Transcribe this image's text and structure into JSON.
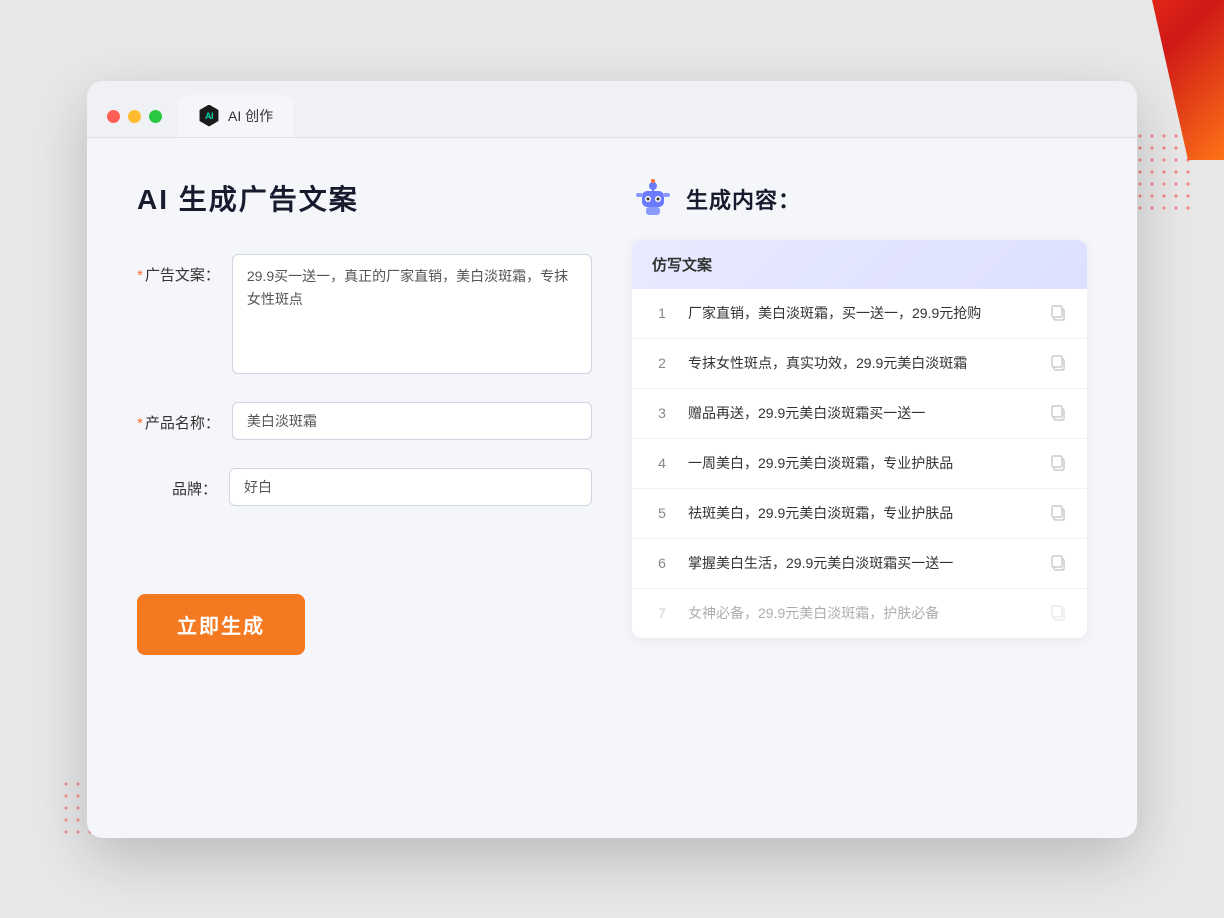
{
  "window": {
    "tab_label": "AI 创作",
    "dot_colors": [
      "#ff5f57",
      "#febc2e",
      "#28c840"
    ]
  },
  "left_panel": {
    "title": "AI 生成广告文案",
    "form": {
      "ad_copy_label": "广告文案：",
      "ad_copy_required": "*",
      "ad_copy_value": "29.9买一送一，真正的厂家直销，美白淡斑霜，专抹女性斑点",
      "product_name_label": "产品名称：",
      "product_name_required": "*",
      "product_name_value": "美白淡斑霜",
      "brand_label": "品牌：",
      "brand_value": "好白",
      "generate_btn": "立即生成"
    }
  },
  "right_panel": {
    "title": "生成内容：",
    "table_header": "仿写文案",
    "results": [
      {
        "num": 1,
        "text": "厂家直销，美白淡斑霜，买一送一，29.9元抢购",
        "dimmed": false
      },
      {
        "num": 2,
        "text": "专抹女性斑点，真实功效，29.9元美白淡斑霜",
        "dimmed": false
      },
      {
        "num": 3,
        "text": "赠品再送，29.9元美白淡斑霜买一送一",
        "dimmed": false
      },
      {
        "num": 4,
        "text": "一周美白，29.9元美白淡斑霜，专业护肤品",
        "dimmed": false
      },
      {
        "num": 5,
        "text": "祛斑美白，29.9元美白淡斑霜，专业护肤品",
        "dimmed": false
      },
      {
        "num": 6,
        "text": "掌握美白生活，29.9元美白淡斑霜买一送一",
        "dimmed": false
      },
      {
        "num": 7,
        "text": "女神必备，29.9元美白淡斑霜，护肤必备",
        "dimmed": true
      }
    ]
  }
}
